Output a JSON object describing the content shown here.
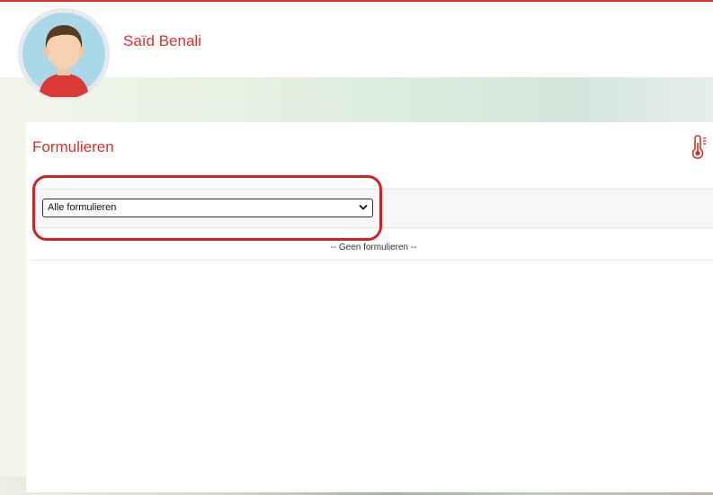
{
  "user": {
    "name": "Saïd Benali"
  },
  "page": {
    "title": "Formulieren"
  },
  "filter": {
    "selected_value": "Alle formulieren"
  },
  "results": {
    "empty_message": "-- Geen formulieren --"
  },
  "icons": {
    "avatar": "person-avatar",
    "temperature": "thermometer-icon",
    "dropdown": "chevron-down-icon"
  },
  "colors": {
    "accent": "#d9312b",
    "highlight": "#d0202a"
  }
}
